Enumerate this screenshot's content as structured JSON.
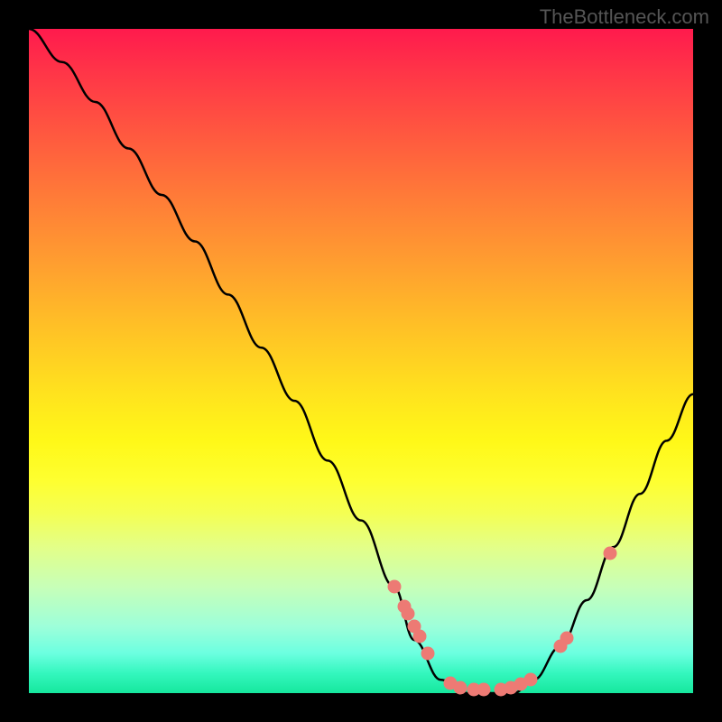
{
  "attribution": "TheBottleneck.com",
  "chart_data": {
    "type": "line",
    "title": "",
    "xlabel": "",
    "ylabel": "",
    "xlim": [
      0,
      100
    ],
    "ylim": [
      0,
      100
    ],
    "series": [
      {
        "name": "bottleneck-curve",
        "x": [
          0,
          5,
          10,
          15,
          20,
          25,
          30,
          35,
          40,
          45,
          50,
          55,
          58,
          62,
          66,
          70,
          73,
          76,
          80,
          84,
          88,
          92,
          96,
          100
        ],
        "y": [
          100,
          95,
          89,
          82,
          75,
          68,
          60,
          52,
          44,
          35,
          26,
          16,
          8,
          2,
          0,
          0,
          0,
          2,
          7,
          14,
          22,
          30,
          38,
          45
        ]
      }
    ],
    "markers": {
      "name": "highlight-dots",
      "x": [
        55.0,
        56.5,
        57.0,
        58.0,
        58.8,
        60.0,
        63.5,
        65.0,
        67.0,
        68.5,
        71.0,
        72.5,
        74.0,
        75.5,
        80.0,
        81.0,
        87.5
      ],
      "y": [
        16.0,
        13.0,
        12.0,
        10.0,
        8.5,
        6.0,
        1.5,
        0.8,
        0.5,
        0.5,
        0.5,
        0.8,
        1.3,
        2.0,
        7.0,
        8.3,
        21.0
      ]
    },
    "background": {
      "type": "vertical-gradient",
      "stops": [
        {
          "pos": 0,
          "color": "#ff1a4d"
        },
        {
          "pos": 55,
          "color": "#ffe31e"
        },
        {
          "pos": 100,
          "color": "#16e79d"
        }
      ]
    }
  }
}
